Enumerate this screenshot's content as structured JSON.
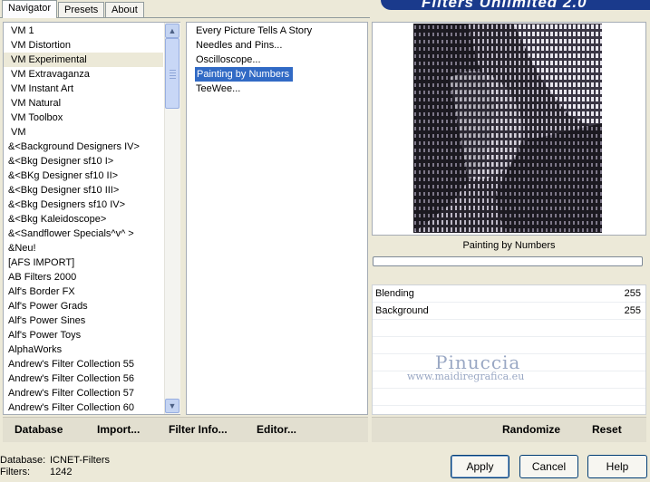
{
  "tabs": [
    {
      "label": "Navigator",
      "active": true
    },
    {
      "label": "Presets",
      "active": false
    },
    {
      "label": "About",
      "active": false
    }
  ],
  "banner_title": "Filters Unlimited 2.0",
  "categories": [
    "VM 1",
    "VM Distortion",
    "VM Experimental",
    "VM Extravaganza",
    "VM Instant Art",
    "VM Natural",
    "VM Toolbox",
    "VM",
    "&<Background Designers IV>",
    "&<Bkg Designer sf10 I>",
    "&<BKg Designer sf10 II>",
    "&<Bkg Designer sf10 III>",
    "&<Bkg Designers sf10 IV>",
    "&<Bkg Kaleidoscope>",
    "&<Sandflower Specials^v^ >",
    "&Neu!",
    "[AFS IMPORT]",
    "AB Filters 2000",
    "Alf's Border FX",
    "Alf's Power Grads",
    "Alf's Power Sines",
    "Alf's Power Toys",
    "AlphaWorks",
    "Andrew's Filter Collection 55",
    "Andrew's Filter Collection 56",
    "Andrew's Filter Collection 57",
    "Andrew's Filter Collection 60"
  ],
  "selected_category": "VM Experimental",
  "filters": [
    "Every Picture Tells A Story",
    "Needles and Pins...",
    "Oscilloscope...",
    "Painting by Numbers",
    "TeeWee..."
  ],
  "selected_filter": "Painting by Numbers",
  "preview": {
    "filter_name": "Painting by Numbers",
    "progress": 0
  },
  "params": [
    {
      "label": "Blending",
      "value": "255"
    },
    {
      "label": "Background",
      "value": "255"
    }
  ],
  "watermark": {
    "name": "Pinuccia",
    "site": "www.maidiregrafica.eu"
  },
  "actions_left": {
    "database": "Database",
    "import": "Import...",
    "filter_info": "Filter Info...",
    "editor": "Editor..."
  },
  "actions_right": {
    "randomize": "Randomize",
    "reset": "Reset"
  },
  "status": {
    "database_label": "Database:",
    "database_value": "ICNET-Filters",
    "filters_label": "Filters:",
    "filters_value": "1242"
  },
  "buttons": {
    "apply": "Apply",
    "cancel": "Cancel",
    "help": "Help"
  },
  "scroll_icons": {
    "up": "arrow-up-icon",
    "down": "arrow-down-icon"
  }
}
